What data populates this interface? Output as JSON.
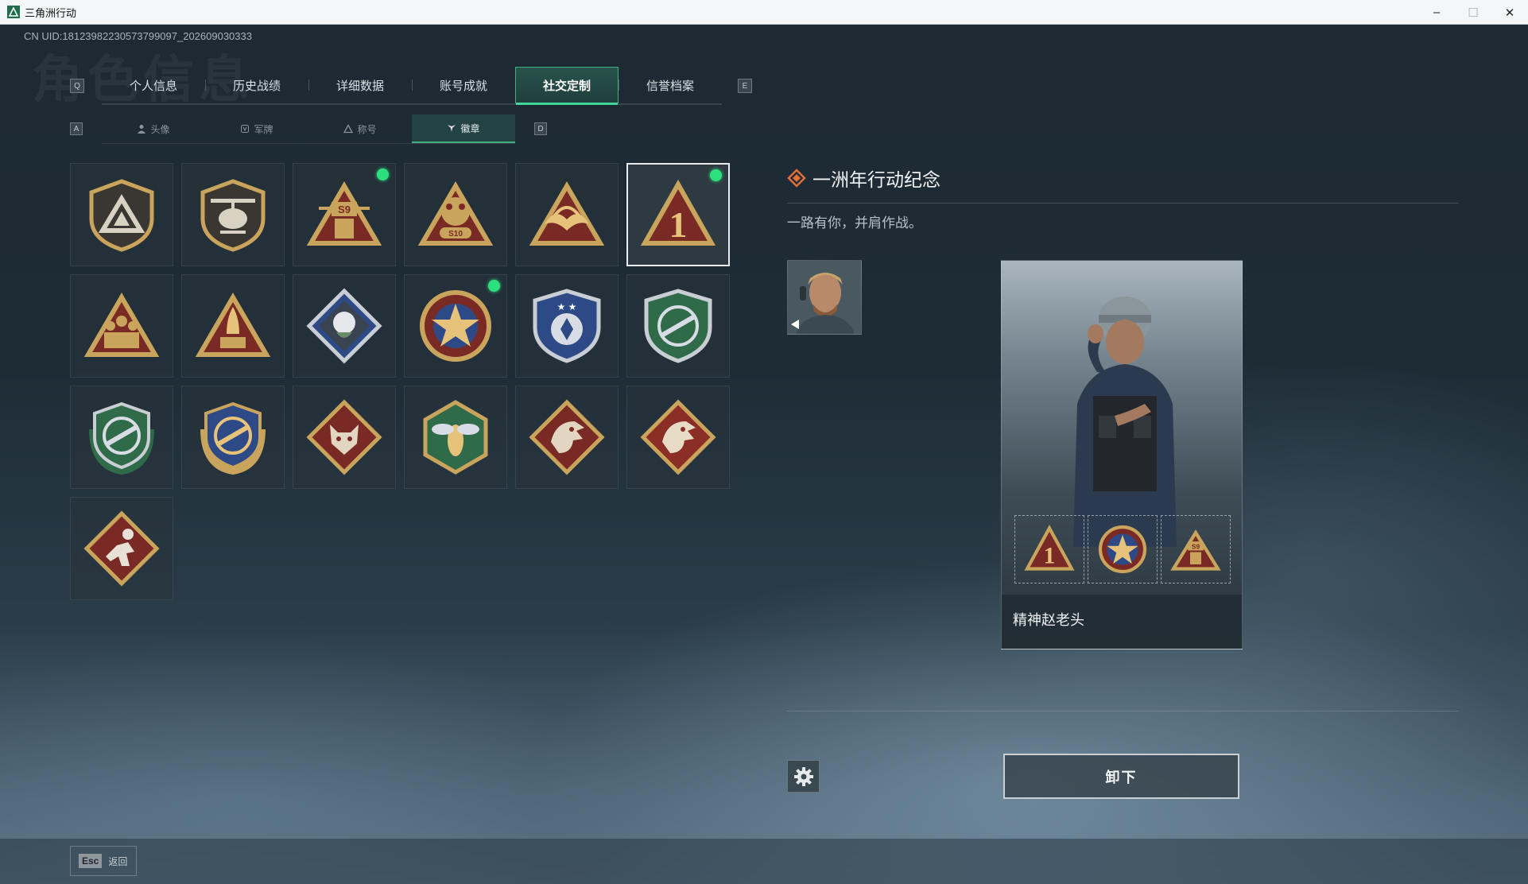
{
  "window": {
    "title": "三角洲行动",
    "minimize": "–",
    "maximize": "☐",
    "close": "✕"
  },
  "uid": "CN UID:1812398223057379909​7_202609030333",
  "watermark": "角色信息",
  "keys": {
    "prev_tab": "Q",
    "next_tab": "E",
    "prev_sub": "A",
    "next_sub": "D"
  },
  "tabs": [
    {
      "label": "个人信息"
    },
    {
      "label": "历史战绩"
    },
    {
      "label": "详细数据"
    },
    {
      "label": "账号成就"
    },
    {
      "label": "社交定制",
      "active": true
    },
    {
      "label": "信誉档案"
    }
  ],
  "subtabs": [
    {
      "label": "头像",
      "icon": "person-icon"
    },
    {
      "label": "军牌",
      "icon": "dogtag-icon"
    },
    {
      "label": "称号",
      "icon": "triangle-icon"
    },
    {
      "label": "徽章",
      "icon": "badge-icon",
      "active": true
    }
  ],
  "badges": [
    {
      "name": "triangle-shield-badge",
      "new": false
    },
    {
      "name": "helicopter-badge",
      "new": false
    },
    {
      "name": "s9-operator-badge",
      "new": true
    },
    {
      "name": "s10-cat-fist-badge",
      "new": false
    },
    {
      "name": "wings-triangle-badge",
      "new": false
    },
    {
      "name": "one-year-anniversary-badge",
      "new": true,
      "selected": true
    },
    {
      "name": "squad-triangle-badge",
      "new": false
    },
    {
      "name": "rocket-triangle-badge",
      "new": false
    },
    {
      "name": "rose-diamond-badge",
      "new": false
    },
    {
      "name": "star-medal-badge",
      "new": true
    },
    {
      "name": "blue-shield-badge",
      "new": false
    },
    {
      "name": "green-rifle-badge",
      "new": false
    },
    {
      "name": "green-rifle-laurel-badge",
      "new": false
    },
    {
      "name": "gold-rifle-laurel-badge",
      "new": false
    },
    {
      "name": "wolf-diamond-badge",
      "new": false
    },
    {
      "name": "wasp-hexagon-badge",
      "new": false
    },
    {
      "name": "dragon-diamond-badge",
      "new": false
    },
    {
      "name": "dragon-diamond-red-badge",
      "new": false
    },
    {
      "name": "runner-diamond-badge",
      "new": false
    }
  ],
  "detail": {
    "title": "一洲年行动纪念",
    "description": "一路有你，并肩作战。",
    "player_name": "精神赵老头",
    "unequip_label": "卸下"
  },
  "footer": {
    "esc_key": "Esc",
    "esc_label": "返回"
  },
  "colors": {
    "accent": "#3fae80",
    "new_dot": "#2de07e",
    "badge_gold": "#c9a45c",
    "badge_red": "#7a2a24",
    "badge_green": "#2f6b48",
    "badge_blue": "#2e4a86"
  }
}
